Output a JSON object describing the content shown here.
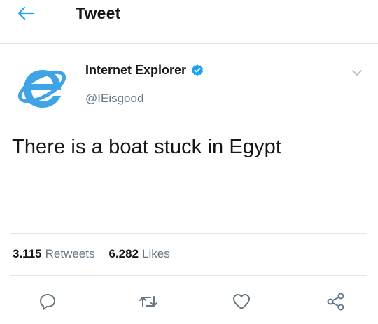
{
  "header": {
    "title": "Tweet"
  },
  "tweet": {
    "author_name": "Internet Explorer",
    "author_handle": "@IEisgood",
    "text": "There is a boat stuck in Egypt",
    "retweets_count": "3.115",
    "retweets_label": "Retweets",
    "likes_count": "6.282",
    "likes_label": "Likes"
  },
  "icons": {
    "back": "arrow-left-icon",
    "avatar": "internet-explorer-logo",
    "verified": "verified-badge-icon",
    "more": "chevron-down-icon",
    "reply": "reply-icon",
    "retweet": "retweet-icon",
    "like": "heart-icon",
    "share": "share-icon"
  },
  "colors": {
    "accent": "#1da1f2",
    "secondary_text": "#657786",
    "primary_text": "#14171a",
    "ie_blue": "#3ea4e6",
    "divider": "#e1e8ed"
  }
}
